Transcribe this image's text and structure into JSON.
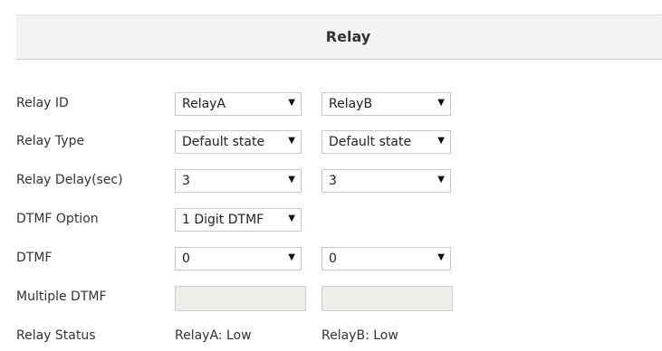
{
  "panel": {
    "title": "Relay"
  },
  "rows": {
    "relay_id": {
      "label": "Relay ID",
      "select_a": "RelayA",
      "select_b": "RelayB"
    },
    "relay_type": {
      "label": "Relay Type",
      "select_a": "Default state",
      "select_b": "Default state"
    },
    "relay_delay": {
      "label": "Relay Delay(sec)",
      "select_a": "3",
      "select_b": "3"
    },
    "dtmf_option": {
      "label": "DTMF Option",
      "select_a": "1 Digit DTMF"
    },
    "dtmf": {
      "label": "DTMF",
      "select_a": "0",
      "select_b": "0"
    },
    "multiple_dtmf": {
      "label": "Multiple DTMF",
      "value_a": "",
      "value_b": ""
    },
    "relay_status": {
      "label": "Relay Status",
      "status_a": "RelayA: Low",
      "status_b": "RelayB: Low"
    }
  },
  "icons": {
    "dropdown_arrow": "chevron-down-icon"
  },
  "colors": {
    "header_background": "#f3f3f3",
    "header_border": "#b9cde3",
    "disabled_input": "#eeedea",
    "text": "#333333"
  }
}
